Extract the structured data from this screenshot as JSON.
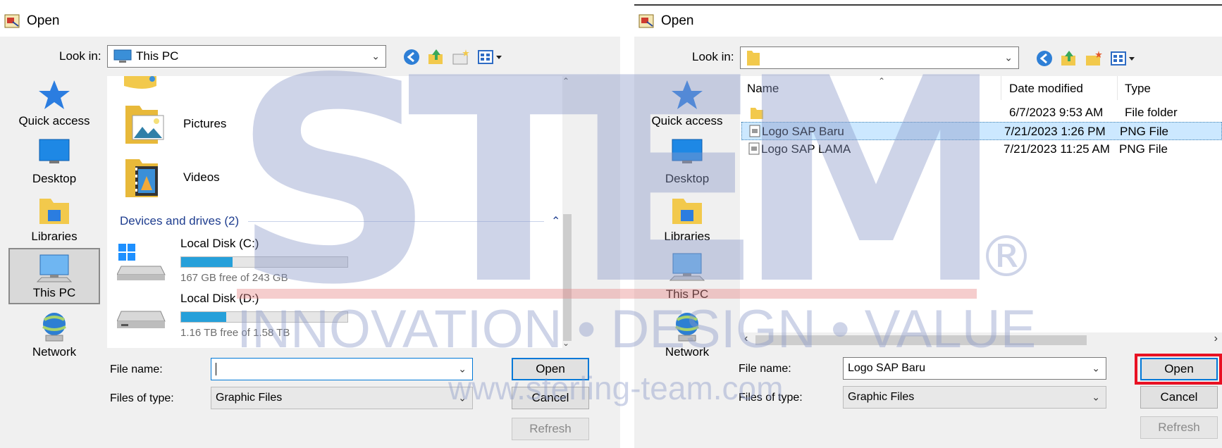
{
  "left": {
    "title": "Open",
    "look_in_label": "Look in:",
    "look_in_value": "This PC",
    "places": [
      {
        "label": "Quick access",
        "icon": "star-icon"
      },
      {
        "label": "Desktop",
        "icon": "desktop-icon"
      },
      {
        "label": "Libraries",
        "icon": "libraries-icon"
      },
      {
        "label": "This PC",
        "icon": "computer-icon",
        "selected": true
      },
      {
        "label": "Network",
        "icon": "network-icon"
      }
    ],
    "folders": [
      {
        "name": "Pictures",
        "icon": "pictures-folder-icon"
      },
      {
        "name": "Videos",
        "icon": "videos-folder-icon"
      }
    ],
    "group_header": "Devices and drives (2)",
    "drives": [
      {
        "name": "Local Disk (C:)",
        "free": "167 GB free of 243 GB",
        "used_fraction": 0.31
      },
      {
        "name": "Local Disk (D:)",
        "free": "1.16 TB free of 1.58 TB",
        "used_fraction": 0.27
      }
    ],
    "file_name_label": "File name:",
    "file_name_value": "",
    "files_of_type_label": "Files of type:",
    "files_of_type_value": "Graphic Files",
    "open_label": "Open",
    "cancel_label": "Cancel",
    "refresh_label": "Refresh"
  },
  "right": {
    "title": "Open",
    "look_in_label": "Look in:",
    "look_in_value": "",
    "places": [
      {
        "label": "Quick access",
        "icon": "star-icon"
      },
      {
        "label": "Desktop",
        "icon": "desktop-icon"
      },
      {
        "label": "Libraries",
        "icon": "libraries-icon"
      },
      {
        "label": "This PC",
        "icon": "computer-icon"
      },
      {
        "label": "Network",
        "icon": "network-icon"
      }
    ],
    "columns": [
      "Name",
      "Date modified",
      "Type"
    ],
    "rows": [
      {
        "name": "",
        "date": "6/7/2023 9:53 AM",
        "type": "File folder",
        "icon": "folder-icon"
      },
      {
        "name": "Logo SAP Baru",
        "date": "7/21/2023 1:26 PM",
        "type": "PNG File",
        "icon": "png-file-icon",
        "selected": true
      },
      {
        "name": "Logo SAP LAMA",
        "date": "7/21/2023 11:25 AM",
        "type": "PNG File",
        "icon": "png-file-icon"
      }
    ],
    "file_name_label": "File name:",
    "file_name_value": "Logo SAP Baru",
    "files_of_type_label": "Files of type:",
    "files_of_type_value": "Graphic Files",
    "open_label": "Open",
    "cancel_label": "Cancel",
    "refresh_label": "Refresh"
  },
  "watermark": {
    "logo": "STEM",
    "registered": "®",
    "tagline": "INNOVATION • DESIGN • VALUE",
    "url": "www.sterling-team.com"
  },
  "colors": {
    "accent": "#0078d7",
    "highlight": "#e81123",
    "selection": "#cce8ff",
    "progress": "#26a0da",
    "watermark": "#8b9ac9"
  }
}
